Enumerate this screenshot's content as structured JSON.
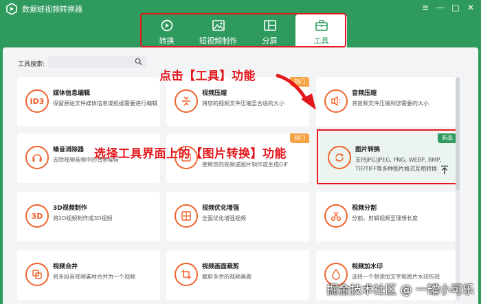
{
  "app": {
    "title": "数据蛙视频转换器"
  },
  "window_controls": {
    "menu": "≡",
    "minimize": "—",
    "maximize": "□",
    "close": "✕"
  },
  "tabs": [
    {
      "label": "转换",
      "icon": "convert-icon"
    },
    {
      "label": "短视频制作",
      "icon": "image-edit-icon"
    },
    {
      "label": "分屏",
      "icon": "split-screen-icon"
    },
    {
      "label": "工具",
      "icon": "toolbox-icon",
      "active": true
    }
  ],
  "search": {
    "label": "工具搜索:",
    "value": ""
  },
  "tools": [
    {
      "name": "媒体信息编辑",
      "desc": "保留原始文件媒体信息或根据需要进行编辑",
      "icon_text": "ID3",
      "badge": ""
    },
    {
      "name": "视频压缩",
      "desc": "将您的视频文件压缩至合适的大小",
      "icon_text": "",
      "badge": "热门"
    },
    {
      "name": "音频压缩",
      "desc": "将音频文件压缩到您需要的大小",
      "icon_text": "",
      "badge": ""
    },
    {
      "name": "噪音消除器",
      "desc": "去除视频音频中的背景噪音",
      "icon_text": "",
      "badge": ""
    },
    {
      "name": "GIF制作",
      "desc": "使用您的视频或图片制作或生成GIF",
      "icon_text": "",
      "badge": "热门"
    },
    {
      "name": "图片转换",
      "desc": "支持JPG/JPEG, PNG, WEBP, BMP, TIF/TIFF等多种图片格式互相转换",
      "icon_text": "",
      "badge": "新品"
    },
    {
      "name": "3D视频制作",
      "desc": "将2D视频制作成3D视频",
      "icon_text": "3D",
      "badge": ""
    },
    {
      "name": "视频优化增强",
      "desc": "全面优化增强视频",
      "icon_text": "",
      "badge": ""
    },
    {
      "name": "视频分割",
      "desc": "分割，剪辑视频至理想长度",
      "icon_text": "",
      "badge": ""
    },
    {
      "name": "视频合并",
      "desc": "将多段音视频素材合并为一个视频",
      "icon_text": "",
      "badge": ""
    },
    {
      "name": "视频画面裁剪",
      "desc": "裁剪多余的视频画面",
      "icon_text": "",
      "badge": ""
    },
    {
      "name": "视频加水印",
      "desc": "选择一个想添加文字和图片水印的视",
      "icon_text": "",
      "badge": ""
    }
  ],
  "annotations": {
    "step1": "点击【工具】功能",
    "step2": "选择工具界面上的【图片转换】功能"
  },
  "watermark": "掘金技术社区 @ 一罐小可乐",
  "colors": {
    "brand": "#2f9a5e",
    "accent": "#f0622c",
    "highlight": "#e3171c",
    "hot": "#f5a344"
  }
}
